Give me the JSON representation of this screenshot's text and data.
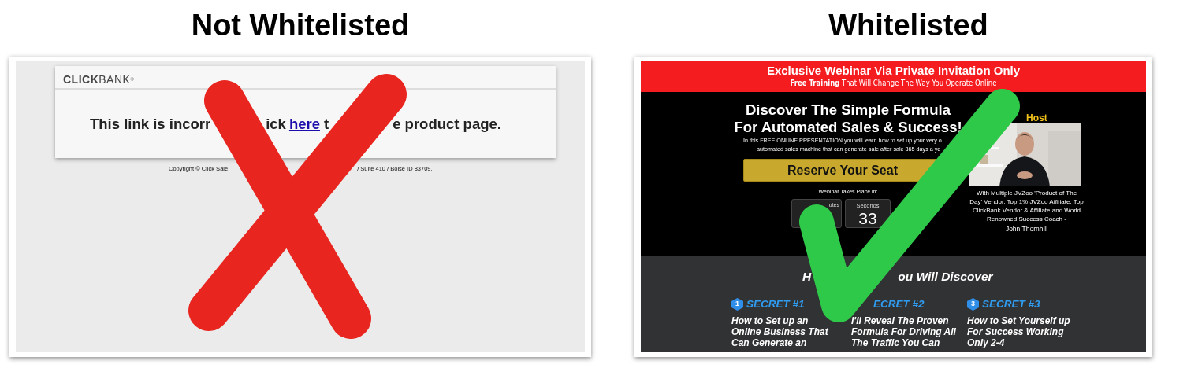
{
  "panels": [
    {
      "heading": "Not Whitelisted",
      "kind": "cross"
    },
    {
      "heading": "Whitelisted",
      "kind": "check"
    }
  ],
  "clickbank_page": {
    "logo": "**CLICK**BANK$^{®}$",
    "message_parts": [
      {
        "text": "This link is incorr",
        "kind": "text"
      },
      {
        "text": "ick",
        "kind": "text"
      },
      {
        "text": "here",
        "kind": "link"
      },
      {
        "text": "t",
        "kind": "text"
      },
      {
        "text": "e product page.",
        "kind": "text"
      }
    ],
    "copyright_parts": [
      "Copyright © Click Sale",
      "/ Suite 410 / Boise ID 83709."
    ]
  },
  "webinar_page": {
    "banner_title": "Exclusive Webinar Via Private Invitation Only",
    "banner_subtitle": "**Free Training** That Will Change The Way You Operate Online",
    "headline_lines": [
      "Discover The Simple Formula",
      "For Automated Sales & Success!"
    ],
    "intro_lines": [
      "In this FREE ONLINE PRESENTATION you will learn how to set up your very o",
      "automated sales machine that can generate sale after sale 365 days a ye"
    ],
    "button": "Reserve Your Seat",
    "countdown_label": "Webinar Takes Place in:",
    "countdown": [
      {
        "label": "utes"
      },
      {
        "label": "Seconds",
        "value": "33"
      }
    ],
    "host_label": "Host",
    "host_bio": "With Multiple JVZoo 'Product of The Day' Vendor, Top 1% JVZoo Affiliate, Top ClickBank Vendor & Affiliate and World Renowned Success Coach -",
    "host_name": "John Thornhill",
    "discover_parts": [
      "H",
      "ou Will Discover"
    ],
    "secrets": [
      {
        "number": "1",
        "title": "SECRET #1",
        "text": "How to Set up an Online Business That Can Generate an"
      },
      {
        "title": "ECRET #2",
        "text": "I'll Reveal The Proven Formula For Driving All The Traffic You Can"
      },
      {
        "number": "3",
        "title": "SECRET #3",
        "text": "How to Set Yourself up For Success Working Only 2-4"
      }
    ]
  }
}
